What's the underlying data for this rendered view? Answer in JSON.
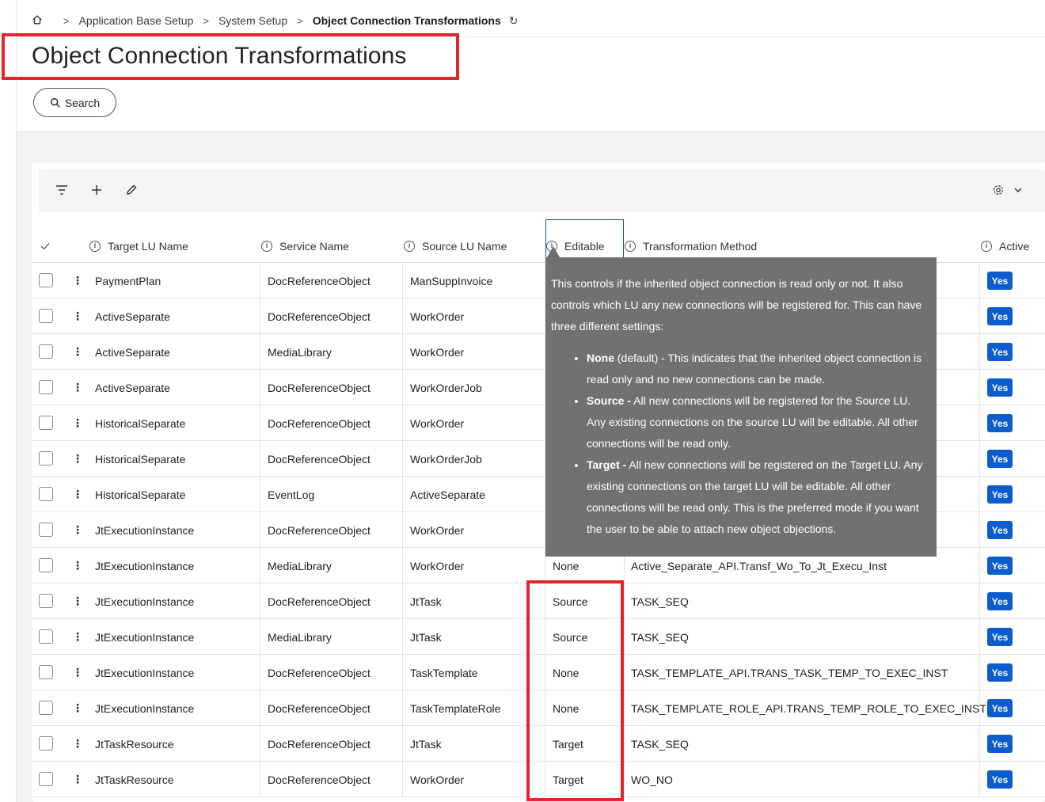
{
  "breadcrumb": {
    "items": [
      "Application Base Setup",
      "System Setup"
    ],
    "current": "Object Connection Transformations"
  },
  "page": {
    "title": "Object Connection Transformations",
    "search_label": "Search"
  },
  "table": {
    "columns": {
      "target_lu": "Target LU Name",
      "service": "Service Name",
      "source_lu": "Source LU Name",
      "editable": "Editable",
      "method": "Transformation Method",
      "active": "Active"
    },
    "rows": [
      {
        "target_lu": "PaymentPlan",
        "service": "DocReferenceObject",
        "source_lu": "ManSuppInvoice",
        "editable": "",
        "method": "",
        "active": "Yes"
      },
      {
        "target_lu": "ActiveSeparate",
        "service": "DocReferenceObject",
        "source_lu": "WorkOrder",
        "editable": "",
        "method": "",
        "active": "Yes"
      },
      {
        "target_lu": "ActiveSeparate",
        "service": "MediaLibrary",
        "source_lu": "WorkOrder",
        "editable": "",
        "method": "",
        "active": "Yes"
      },
      {
        "target_lu": "ActiveSeparate",
        "service": "DocReferenceObject",
        "source_lu": "WorkOrderJob",
        "editable": "",
        "method": "",
        "active": "Yes"
      },
      {
        "target_lu": "HistoricalSeparate",
        "service": "DocReferenceObject",
        "source_lu": "WorkOrder",
        "editable": "",
        "method": "",
        "active": "Yes"
      },
      {
        "target_lu": "HistoricalSeparate",
        "service": "DocReferenceObject",
        "source_lu": "WorkOrderJob",
        "editable": "",
        "method": "",
        "active": "Yes"
      },
      {
        "target_lu": "HistoricalSeparate",
        "service": "EventLog",
        "source_lu": "ActiveSeparate",
        "editable": "",
        "method": "",
        "active": "Yes"
      },
      {
        "target_lu": "JtExecutionInstance",
        "service": "DocReferenceObject",
        "source_lu": "WorkOrder",
        "editable": "",
        "method": "",
        "active": "Yes"
      },
      {
        "target_lu": "JtExecutionInstance",
        "service": "MediaLibrary",
        "source_lu": "WorkOrder",
        "editable": "None",
        "method": "Active_Separate_API.Transf_Wo_To_Jt_Execu_Inst",
        "active": "Yes"
      },
      {
        "target_lu": "JtExecutionInstance",
        "service": "DocReferenceObject",
        "source_lu": "JtTask",
        "editable": "Source",
        "method": "TASK_SEQ",
        "active": "Yes"
      },
      {
        "target_lu": "JtExecutionInstance",
        "service": "MediaLibrary",
        "source_lu": "JtTask",
        "editable": "Source",
        "method": "TASK_SEQ",
        "active": "Yes"
      },
      {
        "target_lu": "JtExecutionInstance",
        "service": "DocReferenceObject",
        "source_lu": "TaskTemplate",
        "editable": "None",
        "method": "TASK_TEMPLATE_API.TRANS_TASK_TEMP_TO_EXEC_INST",
        "active": "Yes"
      },
      {
        "target_lu": "JtExecutionInstance",
        "service": "DocReferenceObject",
        "source_lu": "TaskTemplateRole",
        "editable": "None",
        "method": "TASK_TEMPLATE_ROLE_API.TRANS_TEMP_ROLE_TO_EXEC_INST",
        "active": "Yes"
      },
      {
        "target_lu": "JtTaskResource",
        "service": "DocReferenceObject",
        "source_lu": "JtTask",
        "editable": "Target",
        "method": "TASK_SEQ",
        "active": "Yes"
      },
      {
        "target_lu": "JtTaskResource",
        "service": "DocReferenceObject",
        "source_lu": "WorkOrder",
        "editable": "Target",
        "method": "WO_NO",
        "active": "Yes"
      }
    ]
  },
  "tooltip": {
    "intro": "This controls if the inherited object connection is read only or not. It also controls which LU any new connections will be registered for. This can have three different settings:",
    "options": [
      {
        "term": "None",
        "text": " (default) - This indicates that the inherited object connection is read only and no new connections can be made."
      },
      {
        "term": "Source -",
        "text": " All new connections will be registered for the Source LU. Any existing connections on the source LU will be editable. All other connections will be read only."
      },
      {
        "term": "Target -",
        "text": " All new connections will be registered on the Target LU. Any existing connections on the target LU will be editable. All other connections will be read only. This is the preferred mode if you want the user to be able to attach new object objections."
      }
    ]
  },
  "colors": {
    "accent": "#0b5ccc",
    "highlight": "#e0262d",
    "tooltip_bg": "#6c6c6c"
  },
  "icons": {
    "home": "home-icon",
    "refresh": "refresh-icon",
    "filter": "filter-icon",
    "add": "plus-icon",
    "edit": "pencil-icon",
    "settings": "gear-icon",
    "search": "search-icon"
  }
}
